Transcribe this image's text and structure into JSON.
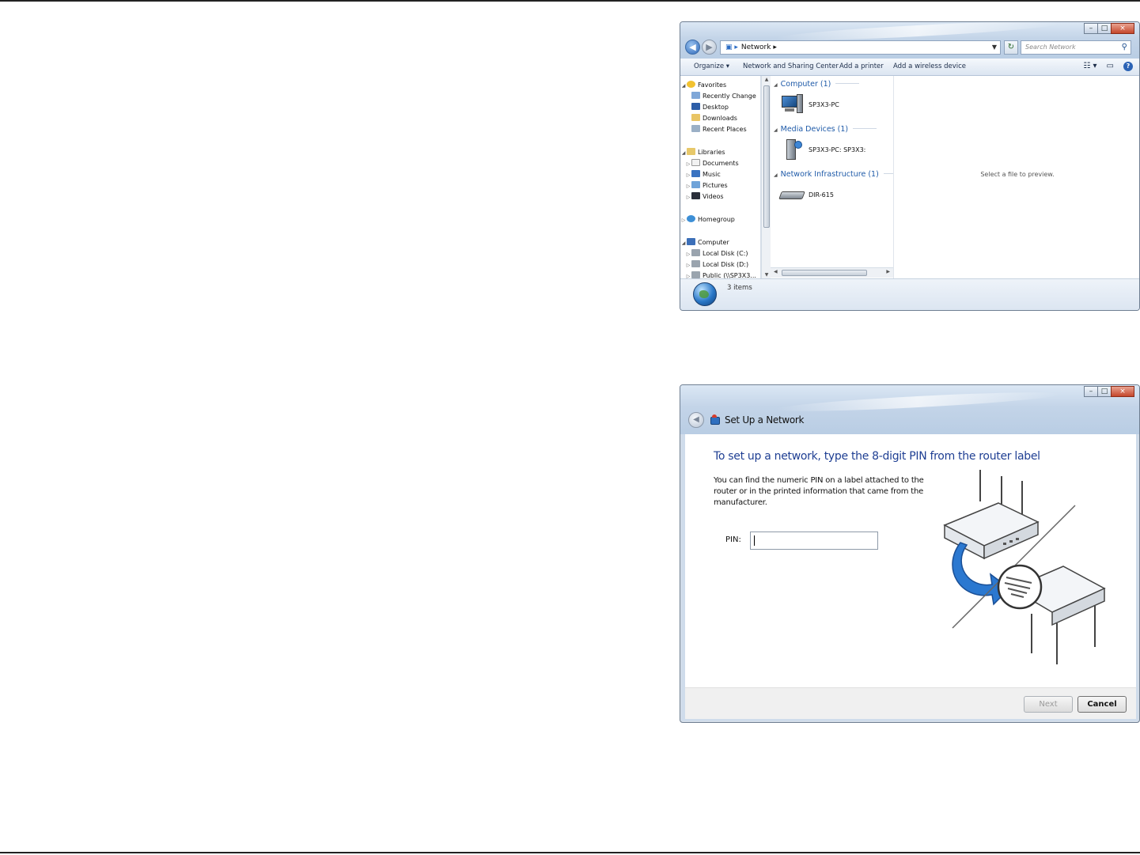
{
  "explorer": {
    "address_path": "Network",
    "search_placeholder": "Search Network",
    "toolbar": {
      "organize": "Organize",
      "network_sharing_center": "Network and Sharing Center",
      "add_printer": "Add a printer",
      "add_wireless_device": "Add a wireless device"
    },
    "nav_pane": {
      "favorites": "Favorites",
      "favorites_items": [
        "Recently Change",
        "Desktop",
        "Downloads",
        "Recent Places"
      ],
      "libraries": "Libraries",
      "libraries_items": [
        "Documents",
        "Music",
        "Pictures",
        "Videos"
      ],
      "homegroup": "Homegroup",
      "computer": "Computer",
      "computer_items": [
        "Local Disk (C:)",
        "Local Disk (D:)",
        "Public (\\\\SP3X3..."
      ]
    },
    "groups": [
      {
        "header": "Computer (1)",
        "item": "SP3X3-PC"
      },
      {
        "header": "Media Devices (1)",
        "item": "SP3X3-PC: SP3X3:"
      },
      {
        "header": "Network Infrastructure (1)",
        "item": "DIR-615"
      }
    ],
    "preview_text": "Select a file to preview.",
    "status_count": "3 items"
  },
  "wizard": {
    "title": "Set Up a Network",
    "heading": "To set up a network, type the 8-digit PIN from the router label",
    "description": "You can find the numeric PIN on a label attached to the router or in the printed information that came from the manufacturer.",
    "pin_label": "PIN:",
    "pin_value": "",
    "next_label": "Next",
    "cancel_label": "Cancel"
  },
  "colors": {
    "heading_blue": "#1f3f93",
    "group_blue": "#1e5aa8",
    "close_red": "#c4462b",
    "arrow_blue": "#2b78d0"
  },
  "icons": {
    "back": "back-arrow-icon",
    "forward": "forward-arrow-icon",
    "search": "search-icon",
    "help": "help-icon",
    "globe": "network-globe-icon",
    "router": "router-icon"
  }
}
